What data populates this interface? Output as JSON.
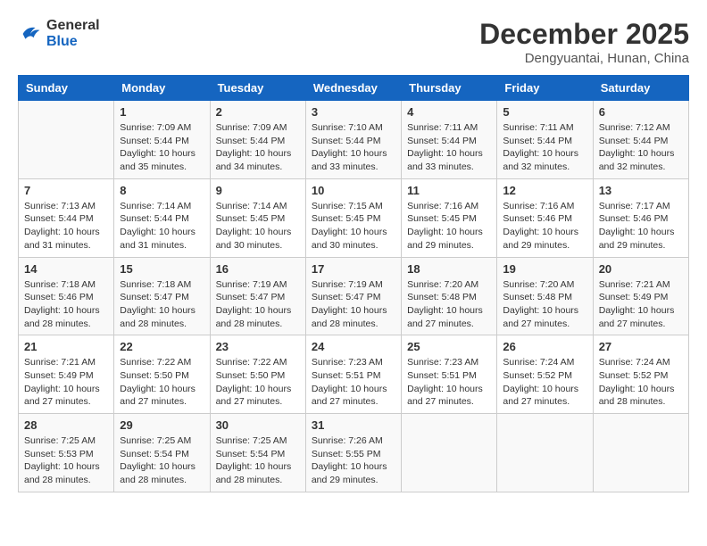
{
  "header": {
    "logo_line1": "General",
    "logo_line2": "Blue",
    "month_year": "December 2025",
    "location": "Dengyuantai, Hunan, China"
  },
  "days_of_week": [
    "Sunday",
    "Monday",
    "Tuesday",
    "Wednesday",
    "Thursday",
    "Friday",
    "Saturday"
  ],
  "weeks": [
    [
      {
        "day": "",
        "info": ""
      },
      {
        "day": "1",
        "info": "Sunrise: 7:09 AM\nSunset: 5:44 PM\nDaylight: 10 hours and 35 minutes."
      },
      {
        "day": "2",
        "info": "Sunrise: 7:09 AM\nSunset: 5:44 PM\nDaylight: 10 hours and 34 minutes."
      },
      {
        "day": "3",
        "info": "Sunrise: 7:10 AM\nSunset: 5:44 PM\nDaylight: 10 hours and 33 minutes."
      },
      {
        "day": "4",
        "info": "Sunrise: 7:11 AM\nSunset: 5:44 PM\nDaylight: 10 hours and 33 minutes."
      },
      {
        "day": "5",
        "info": "Sunrise: 7:11 AM\nSunset: 5:44 PM\nDaylight: 10 hours and 32 minutes."
      },
      {
        "day": "6",
        "info": "Sunrise: 7:12 AM\nSunset: 5:44 PM\nDaylight: 10 hours and 32 minutes."
      }
    ],
    [
      {
        "day": "7",
        "info": "Sunrise: 7:13 AM\nSunset: 5:44 PM\nDaylight: 10 hours and 31 minutes."
      },
      {
        "day": "8",
        "info": "Sunrise: 7:14 AM\nSunset: 5:44 PM\nDaylight: 10 hours and 31 minutes."
      },
      {
        "day": "9",
        "info": "Sunrise: 7:14 AM\nSunset: 5:45 PM\nDaylight: 10 hours and 30 minutes."
      },
      {
        "day": "10",
        "info": "Sunrise: 7:15 AM\nSunset: 5:45 PM\nDaylight: 10 hours and 30 minutes."
      },
      {
        "day": "11",
        "info": "Sunrise: 7:16 AM\nSunset: 5:45 PM\nDaylight: 10 hours and 29 minutes."
      },
      {
        "day": "12",
        "info": "Sunrise: 7:16 AM\nSunset: 5:46 PM\nDaylight: 10 hours and 29 minutes."
      },
      {
        "day": "13",
        "info": "Sunrise: 7:17 AM\nSunset: 5:46 PM\nDaylight: 10 hours and 29 minutes."
      }
    ],
    [
      {
        "day": "14",
        "info": "Sunrise: 7:18 AM\nSunset: 5:46 PM\nDaylight: 10 hours and 28 minutes."
      },
      {
        "day": "15",
        "info": "Sunrise: 7:18 AM\nSunset: 5:47 PM\nDaylight: 10 hours and 28 minutes."
      },
      {
        "day": "16",
        "info": "Sunrise: 7:19 AM\nSunset: 5:47 PM\nDaylight: 10 hours and 28 minutes."
      },
      {
        "day": "17",
        "info": "Sunrise: 7:19 AM\nSunset: 5:47 PM\nDaylight: 10 hours and 28 minutes."
      },
      {
        "day": "18",
        "info": "Sunrise: 7:20 AM\nSunset: 5:48 PM\nDaylight: 10 hours and 27 minutes."
      },
      {
        "day": "19",
        "info": "Sunrise: 7:20 AM\nSunset: 5:48 PM\nDaylight: 10 hours and 27 minutes."
      },
      {
        "day": "20",
        "info": "Sunrise: 7:21 AM\nSunset: 5:49 PM\nDaylight: 10 hours and 27 minutes."
      }
    ],
    [
      {
        "day": "21",
        "info": "Sunrise: 7:21 AM\nSunset: 5:49 PM\nDaylight: 10 hours and 27 minutes."
      },
      {
        "day": "22",
        "info": "Sunrise: 7:22 AM\nSunset: 5:50 PM\nDaylight: 10 hours and 27 minutes."
      },
      {
        "day": "23",
        "info": "Sunrise: 7:22 AM\nSunset: 5:50 PM\nDaylight: 10 hours and 27 minutes."
      },
      {
        "day": "24",
        "info": "Sunrise: 7:23 AM\nSunset: 5:51 PM\nDaylight: 10 hours and 27 minutes."
      },
      {
        "day": "25",
        "info": "Sunrise: 7:23 AM\nSunset: 5:51 PM\nDaylight: 10 hours and 27 minutes."
      },
      {
        "day": "26",
        "info": "Sunrise: 7:24 AM\nSunset: 5:52 PM\nDaylight: 10 hours and 27 minutes."
      },
      {
        "day": "27",
        "info": "Sunrise: 7:24 AM\nSunset: 5:52 PM\nDaylight: 10 hours and 28 minutes."
      }
    ],
    [
      {
        "day": "28",
        "info": "Sunrise: 7:25 AM\nSunset: 5:53 PM\nDaylight: 10 hours and 28 minutes."
      },
      {
        "day": "29",
        "info": "Sunrise: 7:25 AM\nSunset: 5:54 PM\nDaylight: 10 hours and 28 minutes."
      },
      {
        "day": "30",
        "info": "Sunrise: 7:25 AM\nSunset: 5:54 PM\nDaylight: 10 hours and 28 minutes."
      },
      {
        "day": "31",
        "info": "Sunrise: 7:26 AM\nSunset: 5:55 PM\nDaylight: 10 hours and 29 minutes."
      },
      {
        "day": "",
        "info": ""
      },
      {
        "day": "",
        "info": ""
      },
      {
        "day": "",
        "info": ""
      }
    ]
  ]
}
